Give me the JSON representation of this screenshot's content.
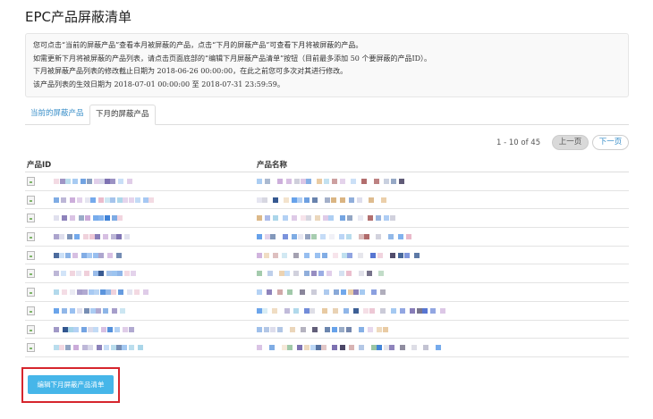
{
  "page": {
    "title": "EPC产品屏蔽清单"
  },
  "notice": {
    "lines": [
      "您可点击“当前的屏蔽产品”查看本月被屏蔽的产品，点击“下月的屏蔽产品”可查看下月将被屏蔽的产品。",
      "如需更新下月将被屏蔽的产品列表，请点击页面底部的“编辑下月屏蔽产品清单”按钮（目前最多添加 50 个要屏蔽的产品ID）。",
      "下月被屏蔽产品列表的修改截止日期为 2018-06-26 00:00:00，在此之前您可多次对其进行修改。",
      "该产品列表的生效日期为 2018-07-01 00:00:00 至 2018-07-31 23:59:59。"
    ]
  },
  "tabs": [
    {
      "label": "当前的屏蔽产品",
      "active": false
    },
    {
      "label": "下月的屏蔽产品",
      "active": true
    }
  ],
  "pagination": {
    "info": "1 - 10 of 45",
    "prev_label": "上一页",
    "next_label": "下一页"
  },
  "table": {
    "columns": [
      "产品ID",
      "产品名称"
    ],
    "row_count": 10,
    "cells_obscured": true
  },
  "footer": {
    "edit_button_label": "编辑下月屏蔽产品清单"
  },
  "colors": {
    "accent": "#3a8fc9",
    "button": "#46b6e9",
    "highlight_outline": "#d6252d"
  }
}
